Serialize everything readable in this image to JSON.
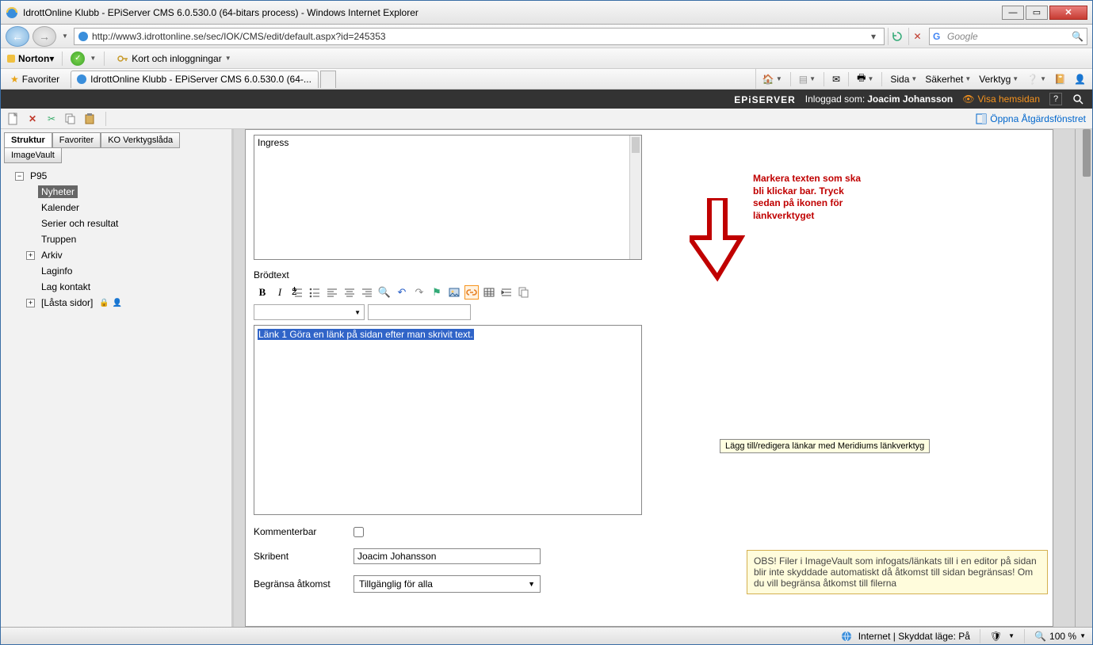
{
  "window": {
    "title": "IdrottOnline Klubb - EPiServer CMS 6.0.530.0 (64-bitars process) - Windows Internet Explorer"
  },
  "nav": {
    "url": "http://www3.idrottonline.se/sec/IOK/CMS/edit/default.aspx?id=245353",
    "search_placeholder": "Google"
  },
  "norton": {
    "brand": "Norton",
    "login_label": "Kort och inloggningar"
  },
  "favbar": {
    "favoriter": "Favoriter",
    "tab_title": "IdrottOnline Klubb - EPiServer CMS 6.0.530.0 (64-..."
  },
  "cmd": {
    "sida": "Sida",
    "sakerhet": "Säkerhet",
    "verktyg": "Verktyg"
  },
  "epi": {
    "logo_a": "EPi",
    "logo_b": "SERVER",
    "user_prefix": "Inloggad som:",
    "user_name": "Joacim Johansson",
    "view_site": "Visa hemsidan",
    "open_action": "Öppna Åtgärdsfönstret"
  },
  "lefttabs": {
    "struktur": "Struktur",
    "favoriter": "Favoriter",
    "ko": "KO Verktygslåda",
    "imagevault": "ImageVault"
  },
  "tree": {
    "root": "P95",
    "items": [
      "Nyheter",
      "Kalender",
      "Serier och resultat",
      "Truppen",
      "Arkiv",
      "Laginfo",
      "Lag kontakt",
      "[Låsta sidor]"
    ]
  },
  "form": {
    "ingress": "Ingress",
    "brodtext": "Brödtext",
    "kommenterbar": "Kommenterbar",
    "skribent": "Skribent",
    "skribent_value": "Joacim Johansson",
    "begransa": "Begränsa åtkomst",
    "begransa_value": "Tillgänglig för alla"
  },
  "editor": {
    "selected_text": "Länk 1 Göra en länk på sidan efter man skrivit text.",
    "tooltip": "Lägg till/redigera länkar med Meridiums länkverktyg"
  },
  "annotation": {
    "line1": "Markera texten som ska",
    "line2": "bli klickar bar. Tryck",
    "line3": "sedan på  ikonen för",
    "line4": "länkverktyget"
  },
  "obs": {
    "text": "OBS! Filer i ImageVault som infogats/länkats till i en editor på sidan blir inte skyddade automatiskt då åtkomst till sidan begränsas! Om du vill begränsa åtkomst till filerna"
  },
  "status": {
    "internet": "Internet | Skyddat läge: På",
    "zoom": "100 %"
  }
}
